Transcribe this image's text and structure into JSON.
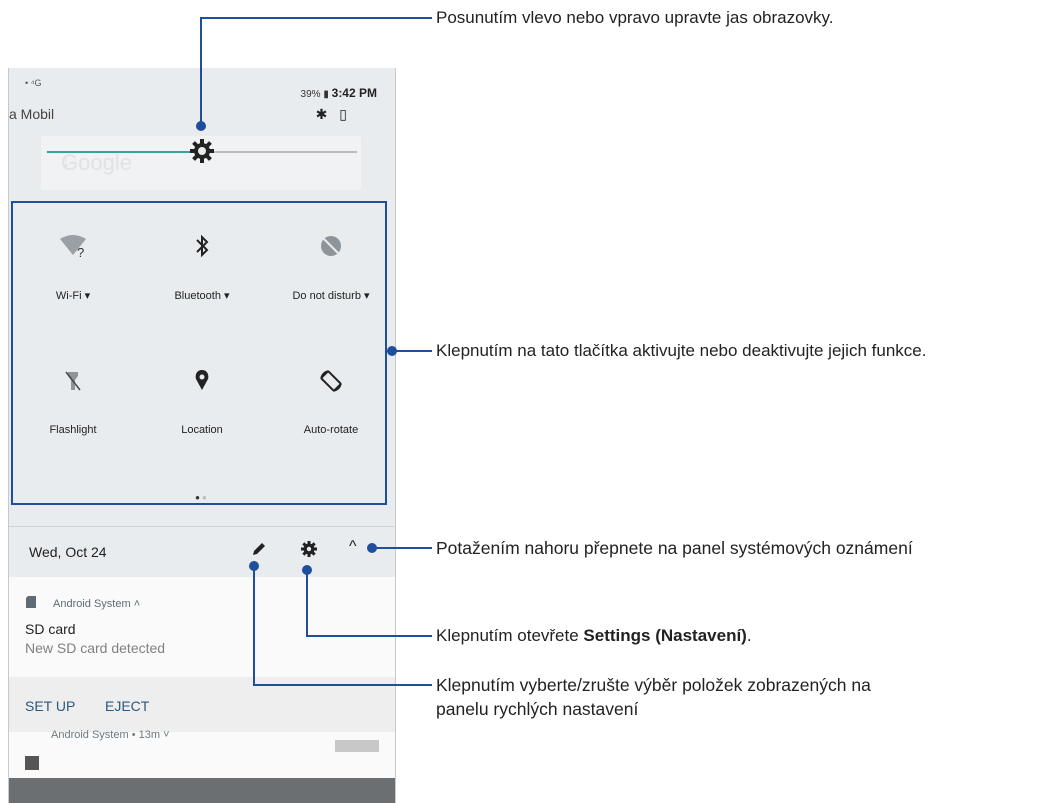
{
  "statusbar": {
    "left_icons_text": "• ⁴G",
    "carrier": "a Mobil",
    "battery": "39%",
    "time": "3:42 PM",
    "icons": "✱ ▯"
  },
  "search_ghost": {
    "text": "Google",
    "mic": "↓"
  },
  "brightness": {
    "level": 0.5
  },
  "tiles": [
    {
      "label": "Wi-Fi",
      "icon_name": "wifi-icon"
    },
    {
      "label": "Bluetooth",
      "icon_name": "bluetooth-icon"
    },
    {
      "label": "Do not disturb",
      "icon_name": "do-not-disturb-icon"
    },
    {
      "label": "Flashlight",
      "icon_name": "flashlight-icon"
    },
    {
      "label": "Location",
      "icon_name": "location-icon"
    },
    {
      "label": "Auto-rotate",
      "icon_name": "auto-rotate-icon"
    }
  ],
  "dropdown_glyph": "▾",
  "page_dots": {
    "active": "●",
    "inactive": "●"
  },
  "date_bar": {
    "date": "Wed, Oct 24",
    "chevron": "^"
  },
  "notification": {
    "app": "Android System ˄",
    "title": "SD card",
    "subtitle": "New SD card detected",
    "actions": [
      "SET UP",
      "EJECT"
    ]
  },
  "notification2": {
    "app": "Android System • 13m ˅"
  },
  "callouts": {
    "brightness": "Posunutím vlevo nebo vpravo upravte jas obrazovky.",
    "tiles": "Klepnutím na tato tlačítka aktivujte nebo deaktivujte jejich funkce.",
    "expand": "Potažením nahoru přepnete na panel systémových oznámení",
    "settings_prefix": "Klepnutím otevřete ",
    "settings_bold": "Settings (Nastavení)",
    "settings_suffix": ".",
    "edit_line1": "Klepnutím vyberte/zrušte výběr položek zobrazených na",
    "edit_line2": "panelu rychlých nastavení"
  },
  "colors": {
    "accent": "#37a39a",
    "callout_line": "#1f4e9c",
    "action_text": "#2b5780"
  }
}
